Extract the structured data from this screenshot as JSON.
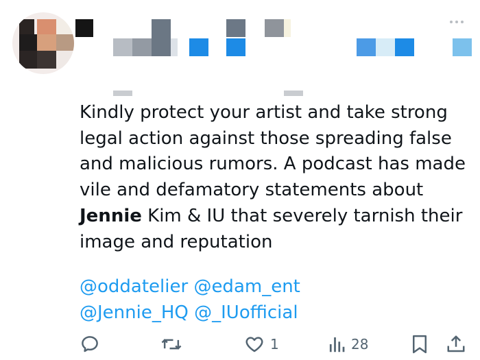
{
  "tweet": {
    "body_part1": "Kindly protect your artist and take strong legal action against those spreading false and malicious rumors. A podcast has made vile and defamatory statements about ",
    "body_bold": "Jennie",
    "body_part2": " Kim & IU that severely tarnish their image and reputation",
    "mentions": [
      "@oddatelier",
      "@edam_ent",
      "@Jennie_HQ",
      "@_IUofficial"
    ]
  },
  "actions": {
    "reply": {
      "icon": "reply-icon"
    },
    "retweet": {
      "icon": "retweet-icon"
    },
    "like": {
      "icon": "heart-icon",
      "count": "1"
    },
    "views": {
      "icon": "analytics-icon",
      "count": "28"
    },
    "bookmark": {
      "icon": "bookmark-icon"
    },
    "share": {
      "icon": "share-icon"
    }
  },
  "colors": {
    "text": "#0f1419",
    "link": "#1d9bf0",
    "secondary": "#536471"
  }
}
